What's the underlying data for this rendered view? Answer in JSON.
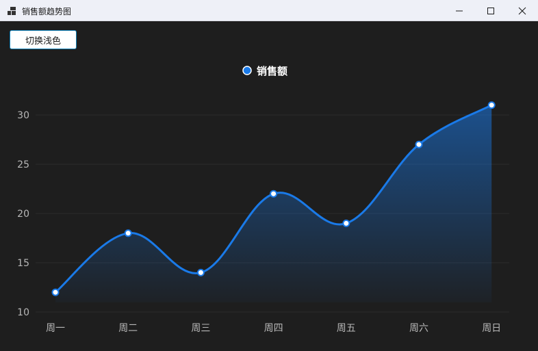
{
  "window": {
    "title": "销售额趋势图",
    "icons": {
      "app": "app-grid-icon",
      "minimize": "minimize-icon",
      "maximize": "maximize-icon",
      "close": "close-icon"
    }
  },
  "toolbar": {
    "toggle_label": "切换浅色"
  },
  "colors": {
    "series": "#1a7ae8",
    "grid": "#2c2c2c",
    "background": "#1e1e1e",
    "point_fill": "#ffffff"
  },
  "chart_data": {
    "type": "line",
    "categories": [
      "周一",
      "周二",
      "周三",
      "周四",
      "周五",
      "周六",
      "周日"
    ],
    "series": [
      {
        "name": "销售额",
        "values": [
          12,
          18,
          14,
          22,
          19,
          27,
          31
        ]
      }
    ],
    "yticks": [
      10,
      15,
      20,
      25,
      30
    ],
    "ylim": [
      10,
      31
    ],
    "smooth": true,
    "area_fill": true,
    "grid": true,
    "legend_position": "top-center"
  }
}
